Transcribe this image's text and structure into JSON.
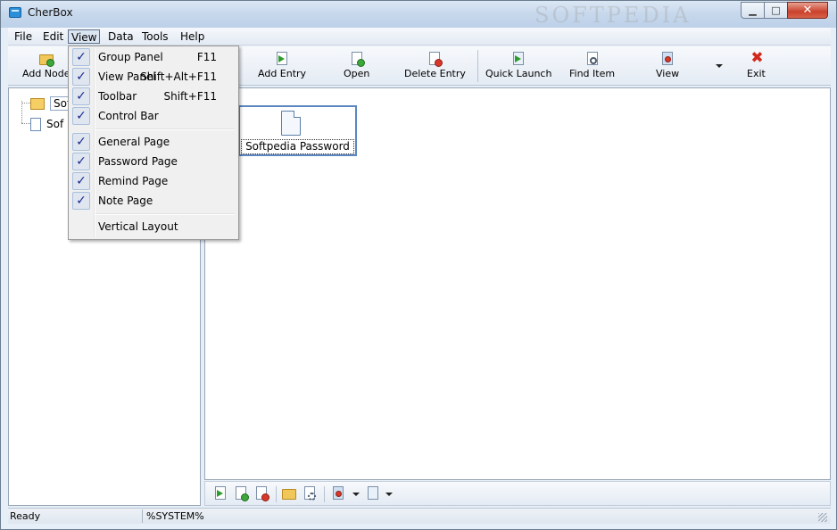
{
  "window": {
    "title": "CherBox",
    "watermark": "SOFTPEDIA",
    "minimize_glyph": "▁",
    "maximize_glyph": "□",
    "close_glyph": "✕"
  },
  "menubar": {
    "items": [
      "File",
      "Edit",
      "View",
      "Data",
      "Tools",
      "Help"
    ],
    "active": "View"
  },
  "toolbar": {
    "buttons": [
      {
        "label": "Add Node",
        "icon": "add-node-icon"
      },
      {
        "label": "Add Entry",
        "icon": "add-entry-icon"
      },
      {
        "label": "Open",
        "icon": "open-icon"
      },
      {
        "label": "Delete Entry",
        "icon": "delete-entry-icon"
      },
      {
        "label": "Quick Launch",
        "icon": "quick-launch-icon"
      },
      {
        "label": "Find Item",
        "icon": "find-item-icon"
      },
      {
        "label": "View",
        "icon": "view-icon"
      },
      {
        "label": "Exit",
        "icon": "exit-icon"
      }
    ]
  },
  "view_menu": {
    "items": [
      {
        "label": "Group Panel",
        "shortcut": "F11",
        "checked": true
      },
      {
        "label": "View Panel",
        "shortcut": "Shift+Alt+F11",
        "checked": true
      },
      {
        "label": "Toolbar",
        "shortcut": "Shift+F11",
        "checked": true
      },
      {
        "label": "Control Bar",
        "shortcut": "",
        "checked": true
      },
      {
        "label": "General Page",
        "shortcut": "",
        "checked": true
      },
      {
        "label": "Password Page",
        "shortcut": "",
        "checked": true
      },
      {
        "label": "Remind Page",
        "shortcut": "",
        "checked": true
      },
      {
        "label": "Note Page",
        "shortcut": "",
        "checked": true
      },
      {
        "label": "Vertical Layout",
        "shortcut": "",
        "checked": false
      }
    ],
    "check_glyph": "✓"
  },
  "tree": {
    "items": [
      {
        "label": "Sof",
        "type": "folder",
        "selected": true
      },
      {
        "label": "Sof",
        "type": "document",
        "selected": false
      }
    ]
  },
  "entries": [
    {
      "label": "Softpedia Password"
    }
  ],
  "statusbar": {
    "status": "Ready",
    "user": "%SYSTEM%"
  },
  "colors": {
    "accent": "#5b86c0",
    "check": "#1b2a8f",
    "close_button": "#c9402b"
  }
}
